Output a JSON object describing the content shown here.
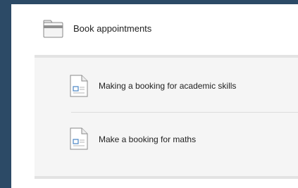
{
  "folder": {
    "label": "Book appointments",
    "icon": "folder-icon"
  },
  "items": [
    {
      "label": "Making a booking for academic skills",
      "icon": "document-icon"
    },
    {
      "label": "Make a booking for maths",
      "icon": "document-icon"
    }
  ],
  "colors": {
    "sidebar": "#2c4a66",
    "panel": "#ffffff",
    "sublist_bg": "#f5f5f5",
    "border": "#e3e3e3"
  }
}
